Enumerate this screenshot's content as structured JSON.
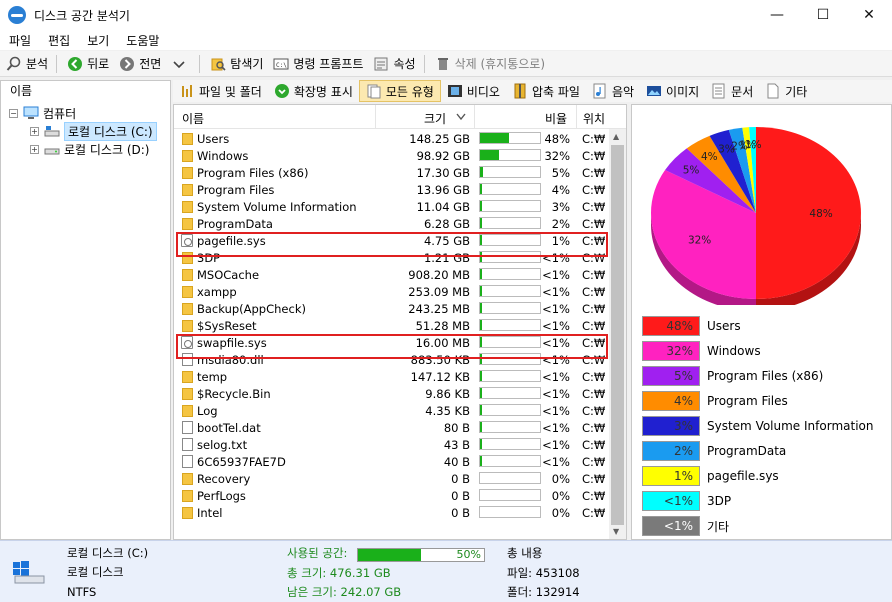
{
  "window": {
    "title": "디스크 공간 분석기",
    "minimize": "—",
    "maximize": "☐",
    "close": "✕"
  },
  "menu": [
    "파일",
    "편집",
    "보기",
    "도움말"
  ],
  "toolbar": {
    "analyze": "분석",
    "back": "뒤로",
    "forward": "전면",
    "explorer": "탐색기",
    "cmd": "명령 프롬프트",
    "properties": "속성",
    "delete": "삭제 (휴지통으로)"
  },
  "tree": {
    "header": "이름",
    "computer": "컴퓨터",
    "drives": [
      "로컬 디스크 (C:)",
      "로컬 디스크 (D:)"
    ]
  },
  "categories": [
    "파일 및 폴더",
    "확장명 표시",
    "모든 유형",
    "비디오",
    "압축 파일",
    "음악",
    "이미지",
    "문서",
    "기타"
  ],
  "columns": {
    "name": "이름",
    "size": "크기",
    "ratio": "비율",
    "location": "위치"
  },
  "rows": [
    {
      "name": "Users",
      "size": "148.25 GB",
      "pct": "48%",
      "fill": 0.48,
      "loc": "C:₩",
      "type": "folder"
    },
    {
      "name": "Windows",
      "size": "98.92 GB",
      "pct": "32%",
      "fill": 0.32,
      "loc": "C:₩",
      "type": "folder"
    },
    {
      "name": "Program Files (x86)",
      "size": "17.30 GB",
      "pct": "5%",
      "fill": 0.05,
      "loc": "C:₩",
      "type": "folder"
    },
    {
      "name": "Program Files",
      "size": "13.96 GB",
      "pct": "4%",
      "fill": 0.04,
      "loc": "C:₩",
      "type": "folder"
    },
    {
      "name": "System Volume Information",
      "size": "11.04 GB",
      "pct": "3%",
      "fill": 0.03,
      "loc": "C:₩",
      "type": "folder"
    },
    {
      "name": "ProgramData",
      "size": "6.28 GB",
      "pct": "2%",
      "fill": 0.02,
      "loc": "C:₩",
      "type": "folder"
    },
    {
      "name": "pagefile.sys",
      "size": "4.75 GB",
      "pct": "1%",
      "fill": 0.01,
      "loc": "C:₩",
      "type": "sys"
    },
    {
      "name": "3DP",
      "size": "1.21 GB",
      "pct": "<1%",
      "fill": 0.005,
      "loc": "C:₩",
      "type": "folder"
    },
    {
      "name": "MSOCache",
      "size": "908.20 MB",
      "pct": "<1%",
      "fill": 0.005,
      "loc": "C:₩",
      "type": "folder"
    },
    {
      "name": "xampp",
      "size": "253.09 MB",
      "pct": "<1%",
      "fill": 0.005,
      "loc": "C:₩",
      "type": "folder"
    },
    {
      "name": "Backup(AppCheck)",
      "size": "243.25 MB",
      "pct": "<1%",
      "fill": 0.005,
      "loc": "C:₩",
      "type": "folder"
    },
    {
      "name": "$SysReset",
      "size": "51.28 MB",
      "pct": "<1%",
      "fill": 0.005,
      "loc": "C:₩",
      "type": "folder"
    },
    {
      "name": "swapfile.sys",
      "size": "16.00 MB",
      "pct": "<1%",
      "fill": 0.005,
      "loc": "C:₩",
      "type": "sys"
    },
    {
      "name": "msdia80.dll",
      "size": "883.50 KB",
      "pct": "<1%",
      "fill": 0.005,
      "loc": "C:₩",
      "type": "file"
    },
    {
      "name": "temp",
      "size": "147.12 KB",
      "pct": "<1%",
      "fill": 0.005,
      "loc": "C:₩",
      "type": "folder"
    },
    {
      "name": "$Recycle.Bin",
      "size": "9.86 KB",
      "pct": "<1%",
      "fill": 0.005,
      "loc": "C:₩",
      "type": "folder"
    },
    {
      "name": "Log",
      "size": "4.35 KB",
      "pct": "<1%",
      "fill": 0.005,
      "loc": "C:₩",
      "type": "folder"
    },
    {
      "name": "bootTel.dat",
      "size": "80 B",
      "pct": "<1%",
      "fill": 0.005,
      "loc": "C:₩",
      "type": "file"
    },
    {
      "name": "selog.txt",
      "size": "43 B",
      "pct": "<1%",
      "fill": 0.005,
      "loc": "C:₩",
      "type": "file"
    },
    {
      "name": "6C65937FAE7D",
      "size": "40 B",
      "pct": "<1%",
      "fill": 0.005,
      "loc": "C:₩",
      "type": "file"
    },
    {
      "name": "Recovery",
      "size": "0 B",
      "pct": "0%",
      "fill": 0,
      "loc": "C:₩",
      "type": "folder"
    },
    {
      "name": "PerfLogs",
      "size": "0 B",
      "pct": "0%",
      "fill": 0,
      "loc": "C:₩",
      "type": "folder"
    },
    {
      "name": "Intel",
      "size": "0 B",
      "pct": "0%",
      "fill": 0,
      "loc": "C:₩",
      "type": "folder"
    }
  ],
  "legend": [
    {
      "pct": "48%",
      "label": "Users",
      "color": "#ff1a1a"
    },
    {
      "pct": "32%",
      "label": "Windows",
      "color": "#ff22c0"
    },
    {
      "pct": "5%",
      "label": "Program Files (x86)",
      "color": "#a020f0"
    },
    {
      "pct": "4%",
      "label": "Program Files",
      "color": "#ff8c00"
    },
    {
      "pct": "3%",
      "label": "System Volume Information",
      "color": "#2020d0"
    },
    {
      "pct": "2%",
      "label": "ProgramData",
      "color": "#1a9bf0"
    },
    {
      "pct": "1%",
      "label": "pagefile.sys",
      "color": "#ffff00"
    },
    {
      "pct": "<1%",
      "label": "3DP",
      "color": "#00ffff"
    },
    {
      "pct": "<1%",
      "label": "기타",
      "color": "#7a7a7a"
    }
  ],
  "pie": {
    "labels": [
      "48%",
      "32%",
      "5%",
      "4%",
      "3%",
      "2%",
      "1%",
      "1%"
    ],
    "values": [
      48,
      32,
      5,
      4,
      3,
      2,
      1,
      1
    ]
  },
  "status": {
    "drive_name": "로컬 디스크 (C:)",
    "drive_type": "로컬 디스크",
    "fs": "NTFS",
    "used_label": "사용된 공간:",
    "used_pct": "50%",
    "used_fill": 0.5,
    "total": "총 크기: 476.31 GB",
    "free": "남은 크기: 242.07 GB",
    "content_label": "총 내용",
    "files": "파일: 453108",
    "folders": "폴더: 132914"
  }
}
